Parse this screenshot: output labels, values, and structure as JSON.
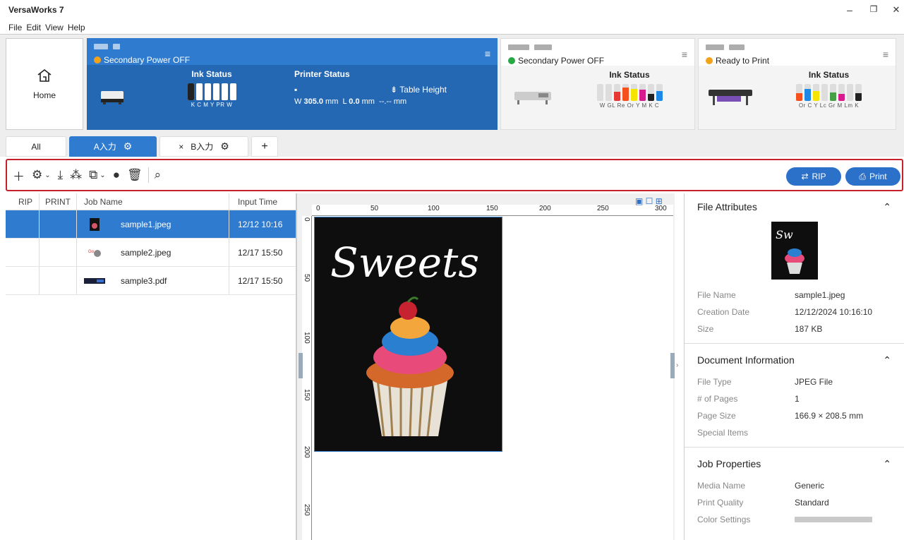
{
  "app": {
    "title": "VersaWorks 7"
  },
  "window": {
    "minimize": "–",
    "restore": "❐",
    "close": "✕"
  },
  "menu": [
    "File",
    "Edit",
    "View",
    "Help"
  ],
  "home": {
    "label": "Home"
  },
  "printers": [
    {
      "status": "Secondary Power OFF",
      "status_color": "#f3a21b",
      "ink_heading": "Ink Status",
      "ink_labels": "K C M Y PR W",
      "printer_status_heading": "Printer Status",
      "table_height_label": "Table Height",
      "width_label": "W",
      "width_value": "305.0",
      "length_label": "L",
      "length_value": "0.0",
      "unit": "mm",
      "extra_value": "--.--"
    },
    {
      "status": "Secondary Power OFF",
      "status_color": "#27a844",
      "ink_heading": "Ink Status",
      "ink_labels": "W GL Re Or Y M K C"
    },
    {
      "status": "Ready to Print",
      "status_color": "#f3a21b",
      "ink_heading": "Ink Status",
      "ink_labels": "Or C Y Lc Gr M Lm K"
    }
  ],
  "tabs": [
    {
      "label": "All"
    },
    {
      "label": "A入力"
    },
    {
      "label": "B入力",
      "close": "×"
    },
    {
      "label": "+"
    }
  ],
  "toolbar": {
    "rip_label": "RIP",
    "print_label": "Print"
  },
  "jobs": {
    "headers": {
      "rip": "RIP",
      "print": "PRINT",
      "name": "Job Name",
      "time": "Input Time"
    },
    "rows": [
      {
        "name": "sample1.jpeg",
        "time": "12/12 10:16"
      },
      {
        "name": "sample2.jpeg",
        "time": "12/17 15:50"
      },
      {
        "name": "sample3.pdf",
        "time": "12/17 15:50"
      }
    ]
  },
  "preview": {
    "artwork_text": "Sweets",
    "ruler_h": [
      "0",
      "50",
      "100",
      "150",
      "200",
      "250",
      "300"
    ],
    "ruler_v": [
      "0",
      "50",
      "100",
      "150",
      "200",
      "250"
    ]
  },
  "file_attributes": {
    "title": "File Attributes",
    "file_name_label": "File Name",
    "file_name": "sample1.jpeg",
    "creation_label": "Creation Date",
    "creation": "12/12/2024 10:16:10",
    "size_label": "Size",
    "size": "187 KB"
  },
  "document_info": {
    "title": "Document Information",
    "type_label": "File Type",
    "type": "JPEG File",
    "pages_label": "# of Pages",
    "pages": "1",
    "page_size_label": "Page Size",
    "page_size": "166.9 × 208.5 mm",
    "special_label": "Special Items"
  },
  "job_properties": {
    "title": "Job Properties",
    "media_label": "Media Name",
    "media": "Generic",
    "quality_label": "Print Quality",
    "quality": "Standard",
    "color_label": "Color Settings"
  },
  "colors": {
    "accent": "#2b70c9",
    "active_card": "#2f7bcf",
    "highlight_border": "#c8202b"
  }
}
